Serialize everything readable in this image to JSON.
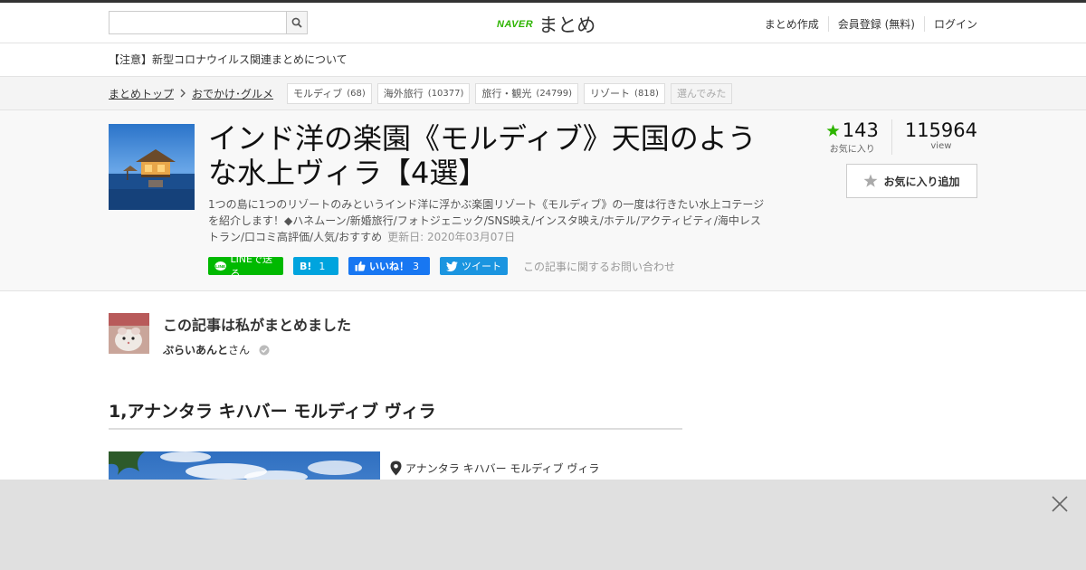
{
  "header": {
    "search_placeholder": "",
    "logo_brand": "NAVER",
    "logo_text": "まとめ",
    "nav": [
      "まとめ作成",
      "会員登録 (無料)",
      "ログイン"
    ]
  },
  "notice": "【注意】新型コロナウイルス関連まとめについて",
  "breadcrumb": {
    "items": [
      "まとめトップ",
      "おでかけ･グルメ"
    ],
    "tags": [
      {
        "label": "モルディブ",
        "count": "(68)"
      },
      {
        "label": "海外旅行",
        "count": "(10377)"
      },
      {
        "label": "旅行・観光",
        "count": "(24799)"
      },
      {
        "label": "リゾート",
        "count": "(818)"
      }
    ],
    "selected_tag": "選んでみた"
  },
  "article": {
    "title": "インド洋の楽園《モルディブ》天国のような水上ヴィラ【4選】",
    "description": "1つの島に1つのリゾートのみというインド洋に浮かぶ楽園リゾート《モルディブ》の一度は行きたい水上コテージを紹介します！◆ハネムーン/新婚旅行/フォトジェニック/SNS映え/インスタ映え/ホテル/アクティビティ/海中レストラン/口コミ高評価/人気/おすすめ",
    "updated": "更新日: 2020年03月07日"
  },
  "share": {
    "line": "LINEで送る",
    "hatena_count": "1",
    "fb_label": "いいね！",
    "fb_count": "3",
    "tweet": "ツイート",
    "contact": "この記事に関するお問い合わせ"
  },
  "stats": {
    "favorites": "143",
    "favorites_label": "お気に入り",
    "views": "115964",
    "views_label": "view",
    "add_favorite": "お気に入り追加"
  },
  "author": {
    "heading": "この記事は私がまとめました",
    "name": "ぷらいあんと",
    "suffix": "さん"
  },
  "section": {
    "heading": "1,アナンタラ キハバー モルディブ ヴィラ",
    "place": "アナンタラ キハバー モルディブ ヴィラ"
  },
  "colors": {
    "accent": "#2db400",
    "line": "#00b900",
    "hatena": "#00a4de",
    "facebook": "#1877f2",
    "twitter": "#1b95e0"
  }
}
